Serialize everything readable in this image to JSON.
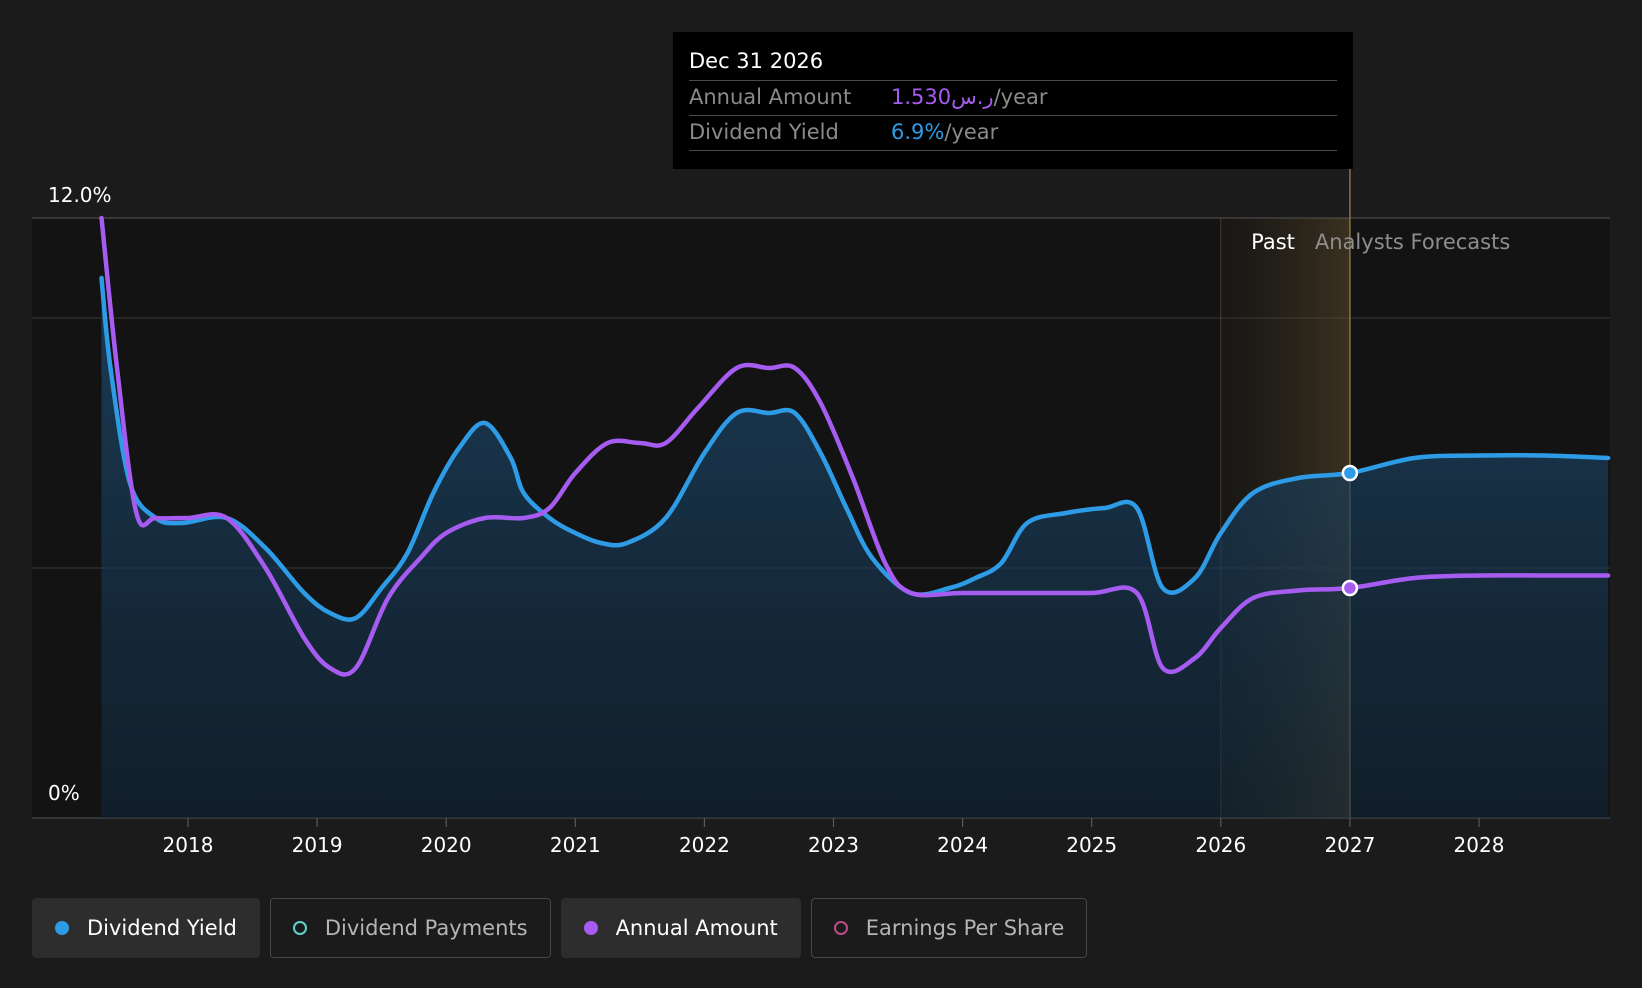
{
  "tooltip": {
    "date": "Dec 31 2026",
    "rows": [
      {
        "label": "Annual Amount",
        "value": "1.530ر.س",
        "unit": "/year"
      },
      {
        "label": "Dividend Yield",
        "value": "6.9%",
        "unit": "/year"
      }
    ]
  },
  "legend": [
    {
      "label": "Dividend Yield",
      "color": "#2e9be6",
      "active": true
    },
    {
      "label": "Dividend Payments",
      "color": "#5fd3c8",
      "active": false
    },
    {
      "label": "Annual Amount",
      "color": "#a65cf0",
      "active": true
    },
    {
      "label": "Earnings Per Share",
      "color": "#c04a8a",
      "active": false
    }
  ],
  "chart_data": {
    "type": "line",
    "y_axis": {
      "top_label": "12.0%",
      "bottom_label": "0%",
      "ylim": [
        0,
        12
      ]
    },
    "x_axis": {
      "ticks": [
        "2018",
        "2019",
        "2020",
        "2021",
        "2022",
        "2023",
        "2024",
        "2025",
        "2026",
        "2027",
        "2028"
      ],
      "xlim": [
        2017.0,
        2029.0
      ]
    },
    "regions": {
      "past_label": "Past",
      "forecast_label": "Analysts Forecasts",
      "past_start": 2026.0,
      "forecast_start": 2027.0
    },
    "grid": true,
    "series": [
      {
        "name": "Dividend Yield",
        "color": "#2e9be6",
        "points": [
          [
            2017.33,
            10.8
          ],
          [
            2017.4,
            9.0
          ],
          [
            2017.55,
            6.7
          ],
          [
            2017.75,
            6.0
          ],
          [
            2017.95,
            5.9
          ],
          [
            2018.3,
            6.0
          ],
          [
            2018.6,
            5.4
          ],
          [
            2018.9,
            4.5
          ],
          [
            2019.1,
            4.1
          ],
          [
            2019.3,
            4.0
          ],
          [
            2019.5,
            4.6
          ],
          [
            2019.7,
            5.3
          ],
          [
            2019.9,
            6.5
          ],
          [
            2020.1,
            7.4
          ],
          [
            2020.3,
            7.9
          ],
          [
            2020.5,
            7.2
          ],
          [
            2020.6,
            6.5
          ],
          [
            2020.8,
            6.0
          ],
          [
            2021.0,
            5.7
          ],
          [
            2021.2,
            5.5
          ],
          [
            2021.4,
            5.5
          ],
          [
            2021.7,
            6.0
          ],
          [
            2022.0,
            7.3
          ],
          [
            2022.25,
            8.1
          ],
          [
            2022.5,
            8.1
          ],
          [
            2022.7,
            8.1
          ],
          [
            2022.9,
            7.3
          ],
          [
            2023.1,
            6.2
          ],
          [
            2023.3,
            5.2
          ],
          [
            2023.6,
            4.5
          ],
          [
            2023.9,
            4.6
          ],
          [
            2024.1,
            4.8
          ],
          [
            2024.3,
            5.1
          ],
          [
            2024.5,
            5.9
          ],
          [
            2024.8,
            6.1
          ],
          [
            2025.1,
            6.2
          ],
          [
            2025.35,
            6.2
          ],
          [
            2025.55,
            4.6
          ],
          [
            2025.8,
            4.8
          ],
          [
            2026.0,
            5.7
          ],
          [
            2026.25,
            6.5
          ],
          [
            2026.6,
            6.8
          ],
          [
            2027.0,
            6.9
          ],
          [
            2027.5,
            7.2
          ],
          [
            2028.0,
            7.25
          ],
          [
            2028.5,
            7.25
          ],
          [
            2029.0,
            7.2
          ]
        ]
      },
      {
        "name": "Annual Amount",
        "color": "#a65cf0",
        "points": [
          [
            2017.33,
            12.0
          ],
          [
            2017.45,
            9.0
          ],
          [
            2017.6,
            6.1
          ],
          [
            2017.75,
            6.0
          ],
          [
            2018.0,
            6.0
          ],
          [
            2018.3,
            6.0
          ],
          [
            2018.6,
            5.0
          ],
          [
            2018.9,
            3.6
          ],
          [
            2019.1,
            3.0
          ],
          [
            2019.3,
            3.0
          ],
          [
            2019.55,
            4.4
          ],
          [
            2019.8,
            5.2
          ],
          [
            2020.0,
            5.7
          ],
          [
            2020.3,
            6.0
          ],
          [
            2020.6,
            6.0
          ],
          [
            2020.8,
            6.2
          ],
          [
            2021.0,
            6.9
          ],
          [
            2021.25,
            7.5
          ],
          [
            2021.5,
            7.5
          ],
          [
            2021.7,
            7.5
          ],
          [
            2021.95,
            8.2
          ],
          [
            2022.25,
            9.0
          ],
          [
            2022.5,
            9.0
          ],
          [
            2022.7,
            9.0
          ],
          [
            2022.9,
            8.3
          ],
          [
            2023.15,
            6.8
          ],
          [
            2023.4,
            5.1
          ],
          [
            2023.6,
            4.5
          ],
          [
            2024.0,
            4.5
          ],
          [
            2024.5,
            4.5
          ],
          [
            2025.0,
            4.5
          ],
          [
            2025.35,
            4.5
          ],
          [
            2025.55,
            3.0
          ],
          [
            2025.8,
            3.2
          ],
          [
            2026.0,
            3.8
          ],
          [
            2026.25,
            4.4
          ],
          [
            2026.6,
            4.55
          ],
          [
            2027.0,
            4.6
          ],
          [
            2027.5,
            4.8
          ],
          [
            2028.0,
            4.85
          ],
          [
            2028.5,
            4.85
          ],
          [
            2029.0,
            4.85
          ]
        ]
      }
    ],
    "highlight_x": 2027.0
  }
}
